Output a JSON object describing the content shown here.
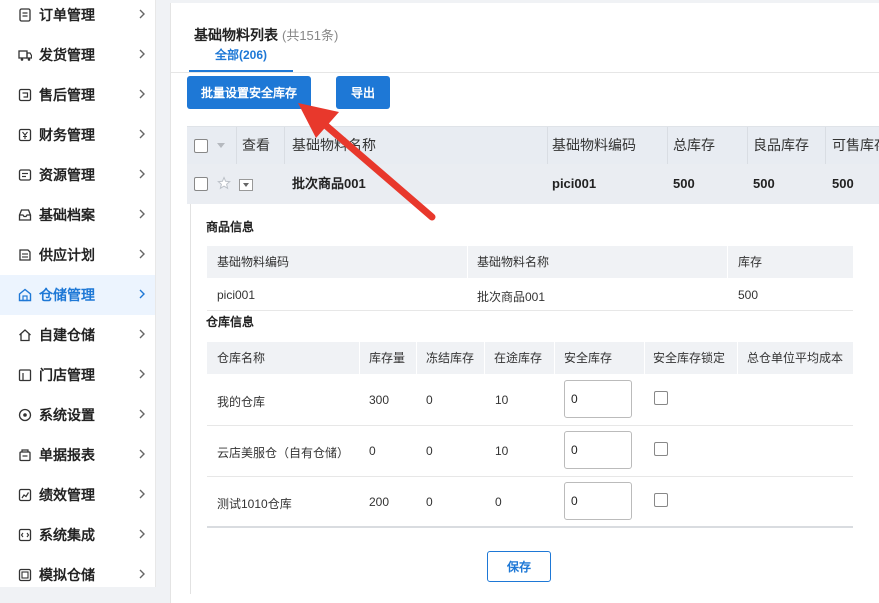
{
  "sidebar": {
    "items": [
      {
        "label": "订单管理",
        "icon": "document-list-icon",
        "active": false
      },
      {
        "label": "发货管理",
        "icon": "truck-icon",
        "active": false
      },
      {
        "label": "售后管理",
        "icon": "return-box-icon",
        "active": false
      },
      {
        "label": "财务管理",
        "icon": "finance-icon",
        "active": false
      },
      {
        "label": "资源管理",
        "icon": "resource-icon",
        "active": false
      },
      {
        "label": "基础档案",
        "icon": "inbox-icon",
        "active": false
      },
      {
        "label": "供应计划",
        "icon": "plan-icon",
        "active": false
      },
      {
        "label": "仓储管理",
        "icon": "warehouse-icon",
        "active": true
      },
      {
        "label": "自建仓储",
        "icon": "home-icon",
        "active": false
      },
      {
        "label": "门店管理",
        "icon": "store-icon",
        "active": false
      },
      {
        "label": "系统设置",
        "icon": "settings-icon",
        "active": false
      },
      {
        "label": "单据报表",
        "icon": "report-icon",
        "active": false
      },
      {
        "label": "绩效管理",
        "icon": "performance-icon",
        "active": false
      },
      {
        "label": "系统集成",
        "icon": "integration-icon",
        "active": false
      },
      {
        "label": "模拟仓储",
        "icon": "simulation-icon",
        "active": false
      }
    ]
  },
  "header": {
    "title": "基础物料列表",
    "count": "(共151条)"
  },
  "tabs": [
    {
      "label": "全部(206)"
    }
  ],
  "toolbar": {
    "batch_label": "批量设置安全库存",
    "export_label": "导出"
  },
  "table": {
    "columns": [
      "查看",
      "基础物料名称",
      "基础物料编码",
      "总库存",
      "良品库存",
      "可售库存"
    ],
    "rows": [
      {
        "name": "批次商品001",
        "code": "pici001",
        "total": "500",
        "good": "500",
        "sellable": "500"
      }
    ]
  },
  "detail": {
    "product_section": "商品信息",
    "product_headers": [
      "基础物料编码",
      "基础物料名称",
      "库存"
    ],
    "product_row": [
      "pici001",
      "批次商品001",
      "500"
    ],
    "warehouse_section": "仓库信息",
    "warehouse_headers": [
      "仓库名称",
      "库存量",
      "冻结库存",
      "在途库存",
      "安全库存",
      "安全库存锁定",
      "总仓单位平均成本"
    ],
    "warehouse_rows": [
      {
        "name": "我的仓库",
        "qty": "300",
        "frozen": "0",
        "transit": "10",
        "safety": "0"
      },
      {
        "name": "云店美服仓（自有仓储）",
        "qty": "0",
        "frozen": "0",
        "transit": "10",
        "safety": "0"
      },
      {
        "name": "测试1010仓库",
        "qty": "200",
        "frozen": "0",
        "transit": "0",
        "safety": "0"
      }
    ],
    "save_label": "保存"
  },
  "colors": {
    "accent": "#1e78d6",
    "arrow": "#e8382c",
    "active_bg": "#ecf4fe"
  }
}
